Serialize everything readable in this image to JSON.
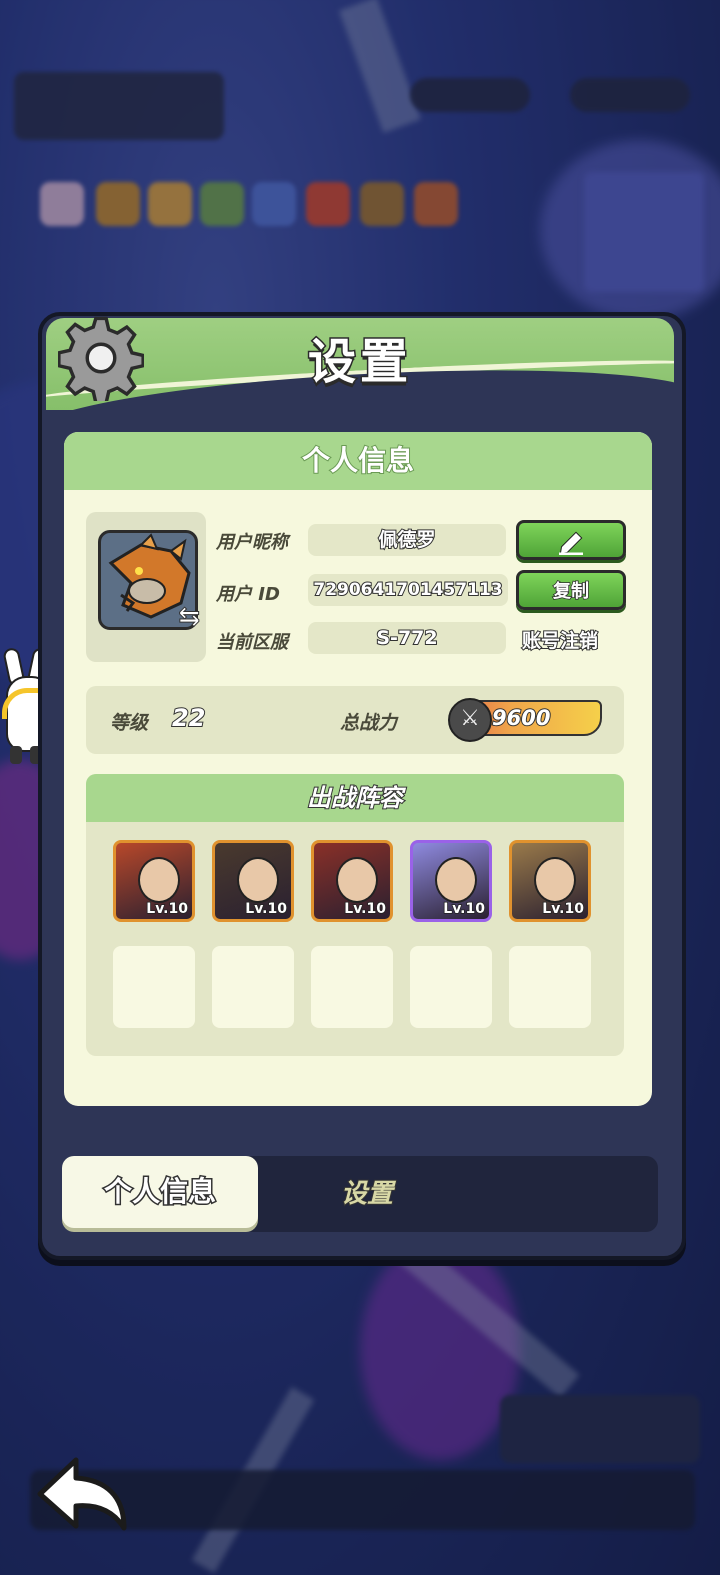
{
  "header": {
    "title": "设置",
    "settings_icon": "gear-icon"
  },
  "profile_section": {
    "title": "个人信息",
    "nickname_label": "用户昵称",
    "nickname_value": "佩德罗",
    "edit_icon": "pencil-icon",
    "id_label": "用户  ID",
    "id_value": "7290641701457113",
    "copy_label": "复制",
    "server_label": "当前区服",
    "server_value": "S-772",
    "delete_account_label": "账号注销",
    "avatar_icon": "swap-icon"
  },
  "stats": {
    "level_label": "等级",
    "level_value": "22",
    "power_label": "总战力",
    "power_value": "9600"
  },
  "team": {
    "title": "出战阵容",
    "heroes": [
      {
        "level": "Lv.10",
        "rarity": "orange",
        "color": "#b8482a"
      },
      {
        "level": "Lv.10",
        "rarity": "orange",
        "color": "#4a3a2e"
      },
      {
        "level": "Lv.10",
        "rarity": "orange",
        "color": "#8a3028"
      },
      {
        "level": "Lv.10",
        "rarity": "purple",
        "color": "#8f8ae0"
      },
      {
        "level": "Lv.10",
        "rarity": "orange",
        "color": "#9a7a4a"
      }
    ],
    "empty_slots": 5
  },
  "tabs": [
    {
      "label": "个人信息",
      "active": true
    },
    {
      "label": "设置",
      "active": false
    }
  ],
  "colors": {
    "accent_green": "#a8d78e",
    "button_green": "#4fa437",
    "panel_dark": "#2e3556",
    "card_bg": "#f6f8dd"
  }
}
